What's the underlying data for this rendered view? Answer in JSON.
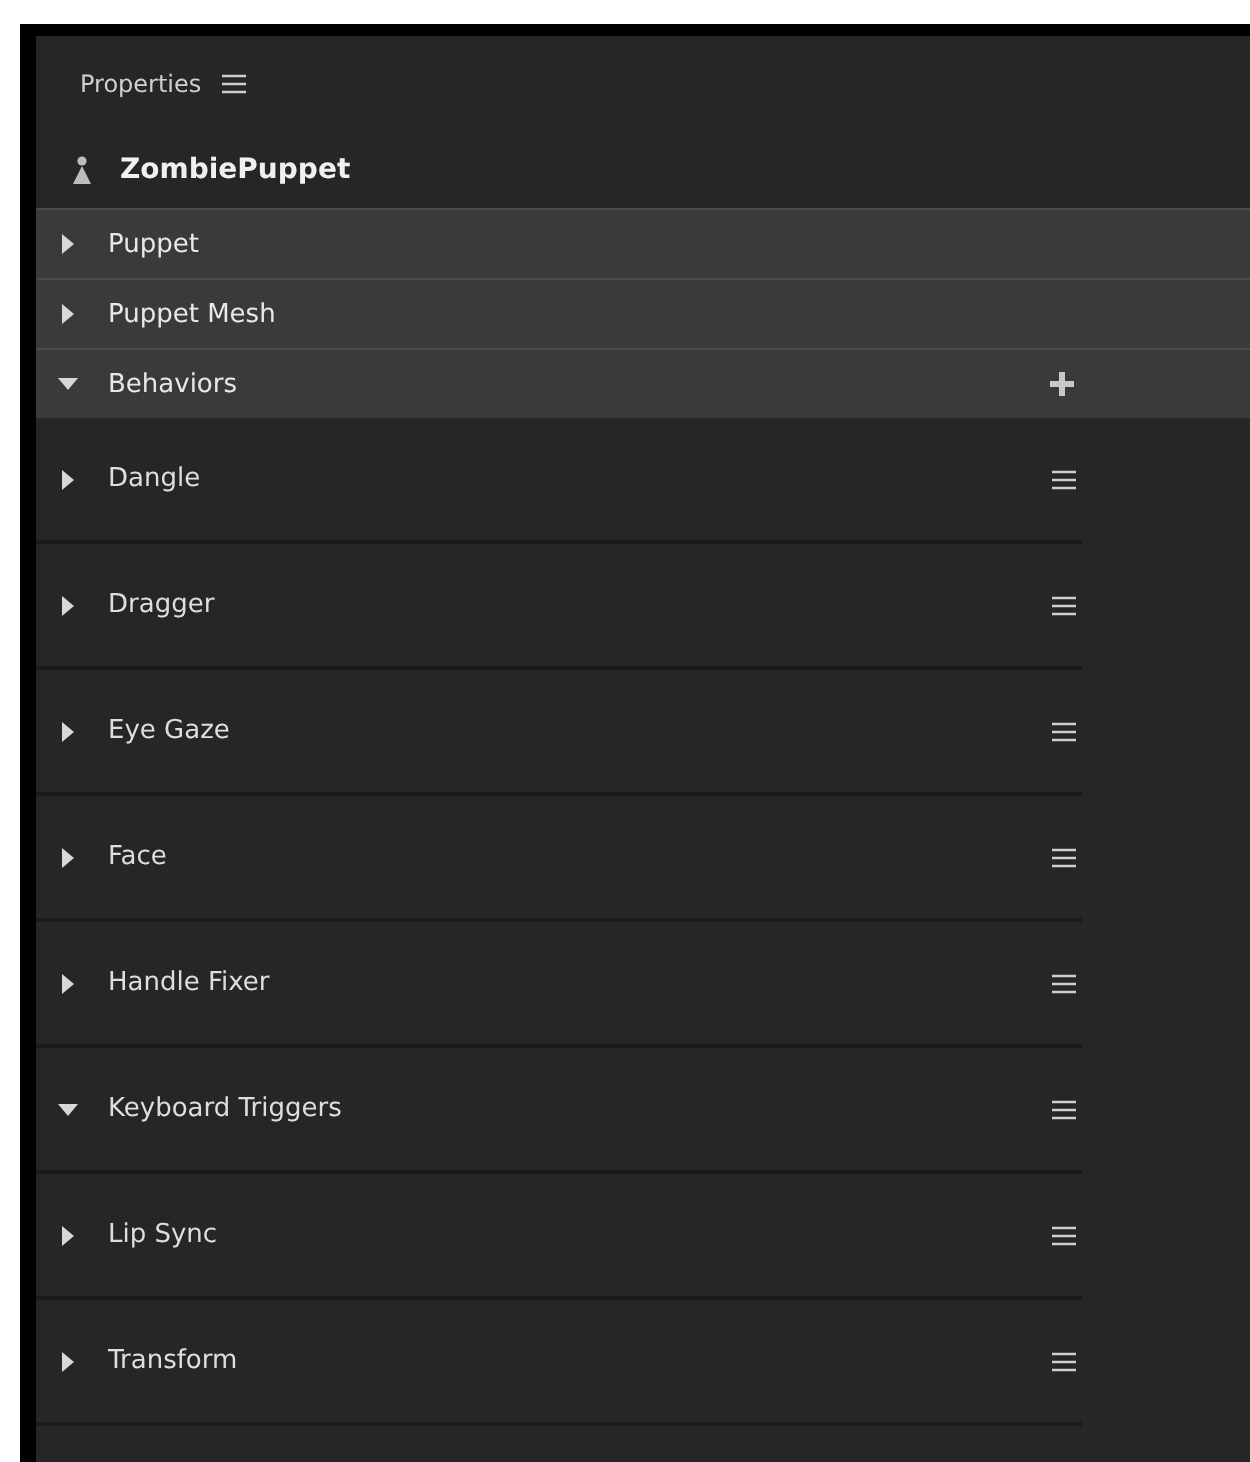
{
  "panel": {
    "title": "Properties"
  },
  "object": {
    "name": "ZombiePuppet"
  },
  "sections": [
    {
      "label": "Puppet",
      "expanded": false,
      "add_button": false
    },
    {
      "label": "Puppet Mesh",
      "expanded": false,
      "add_button": false
    },
    {
      "label": "Behaviors",
      "expanded": true,
      "add_button": true
    }
  ],
  "behaviors": [
    {
      "label": "Dangle",
      "expanded": false
    },
    {
      "label": "Dragger",
      "expanded": false
    },
    {
      "label": "Eye Gaze",
      "expanded": false
    },
    {
      "label": "Face",
      "expanded": false
    },
    {
      "label": "Handle Fixer",
      "expanded": false
    },
    {
      "label": "Keyboard Triggers",
      "expanded": true
    },
    {
      "label": "Lip Sync",
      "expanded": false
    },
    {
      "label": "Transform",
      "expanded": false
    }
  ]
}
